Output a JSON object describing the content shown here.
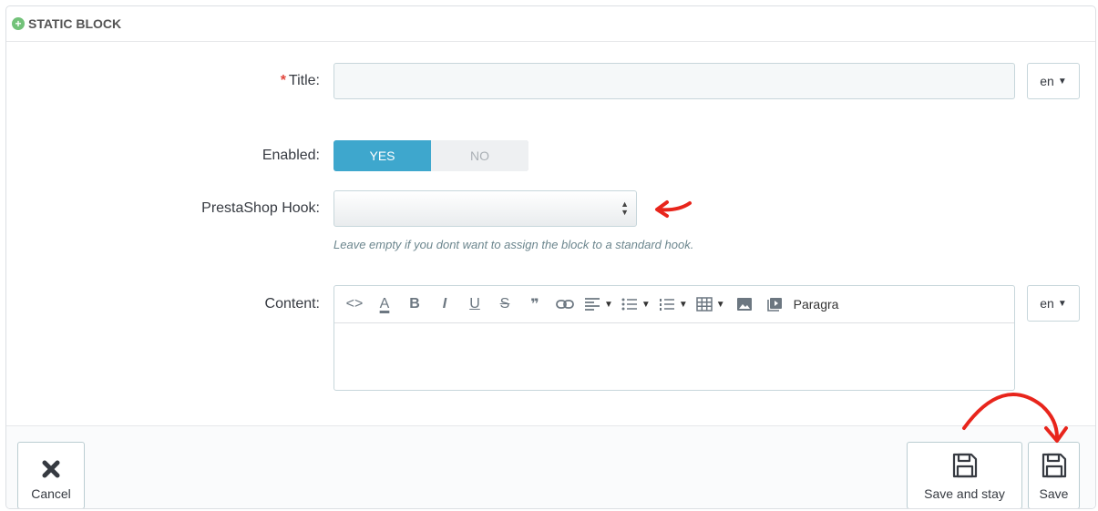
{
  "panel": {
    "heading": "STATIC BLOCK"
  },
  "form": {
    "title": {
      "required_mark": "*",
      "label": "Title:",
      "value": "",
      "lang": "en"
    },
    "enabled": {
      "label": "Enabled:",
      "yes": "YES",
      "no": "NO",
      "selected": "YES"
    },
    "hook": {
      "label": "PrestaShop Hook:",
      "value": "",
      "help": "Leave empty if you dont want to assign the block to a standard hook."
    },
    "content": {
      "label": "Content:",
      "lang": "en",
      "toolbar": {
        "code": "<>",
        "text_color": "A",
        "bold": "B",
        "italic": "I",
        "underline": "U",
        "strike": "S",
        "quote": "❞",
        "format": "Paragra"
      }
    }
  },
  "footer": {
    "cancel": "Cancel",
    "save_and_stay": "Save and stay",
    "save": "Save"
  },
  "colors": {
    "accent": "#3ea7cd",
    "required": "#e2453c",
    "annotation": "#e8251c"
  }
}
